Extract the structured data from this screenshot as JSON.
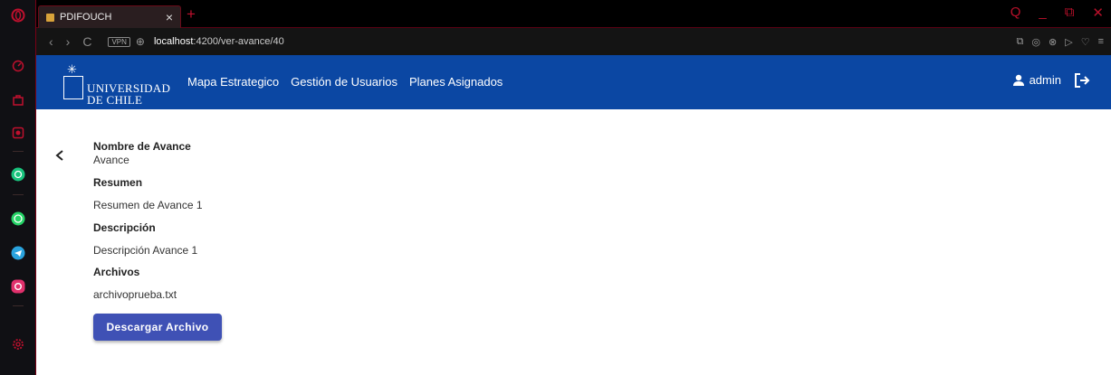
{
  "browser": {
    "tab_title": "PDIFOUCH",
    "tab_close": "×",
    "new_tab": "+",
    "window_controls": {
      "search": "Q",
      "minimize": "_",
      "restore": "⧉",
      "close": "✕"
    },
    "nav": {
      "back": "‹",
      "forward": "›",
      "reload": "C"
    },
    "vpn_label": "VPN",
    "url_host": "localhost",
    "url_path": ":4200/ver-avance/40"
  },
  "sidebar": {
    "icons": [
      "opera-icon",
      "speed-dial-icon",
      "bag-icon",
      "extension-icon",
      "chatgpt-icon",
      "whatsapp-icon",
      "telegram-icon",
      "instagram-icon",
      "settings-icon"
    ]
  },
  "navbar": {
    "logo_line1": "UNIVERSIDAD",
    "logo_line2": "DE CHILE",
    "menu": [
      "Mapa Estrategico",
      "Gestión de Usuarios",
      "Planes Asignados"
    ],
    "username": "admin"
  },
  "details": {
    "nombre_label": "Nombre de Avance",
    "nombre_value": "Avance",
    "resumen_label": "Resumen",
    "resumen_value": "Resumen de Avance 1",
    "descripcion_label": "Descripción",
    "descripcion_value": "Descripción Avance 1",
    "archivos_label": "Archivos",
    "archivo_name": "archivoprueba.txt",
    "download_button": "Descargar Archivo"
  },
  "colors": {
    "navbar": "#0b47a3",
    "button": "#3f51b5",
    "opera_accent": "#c0102e"
  }
}
